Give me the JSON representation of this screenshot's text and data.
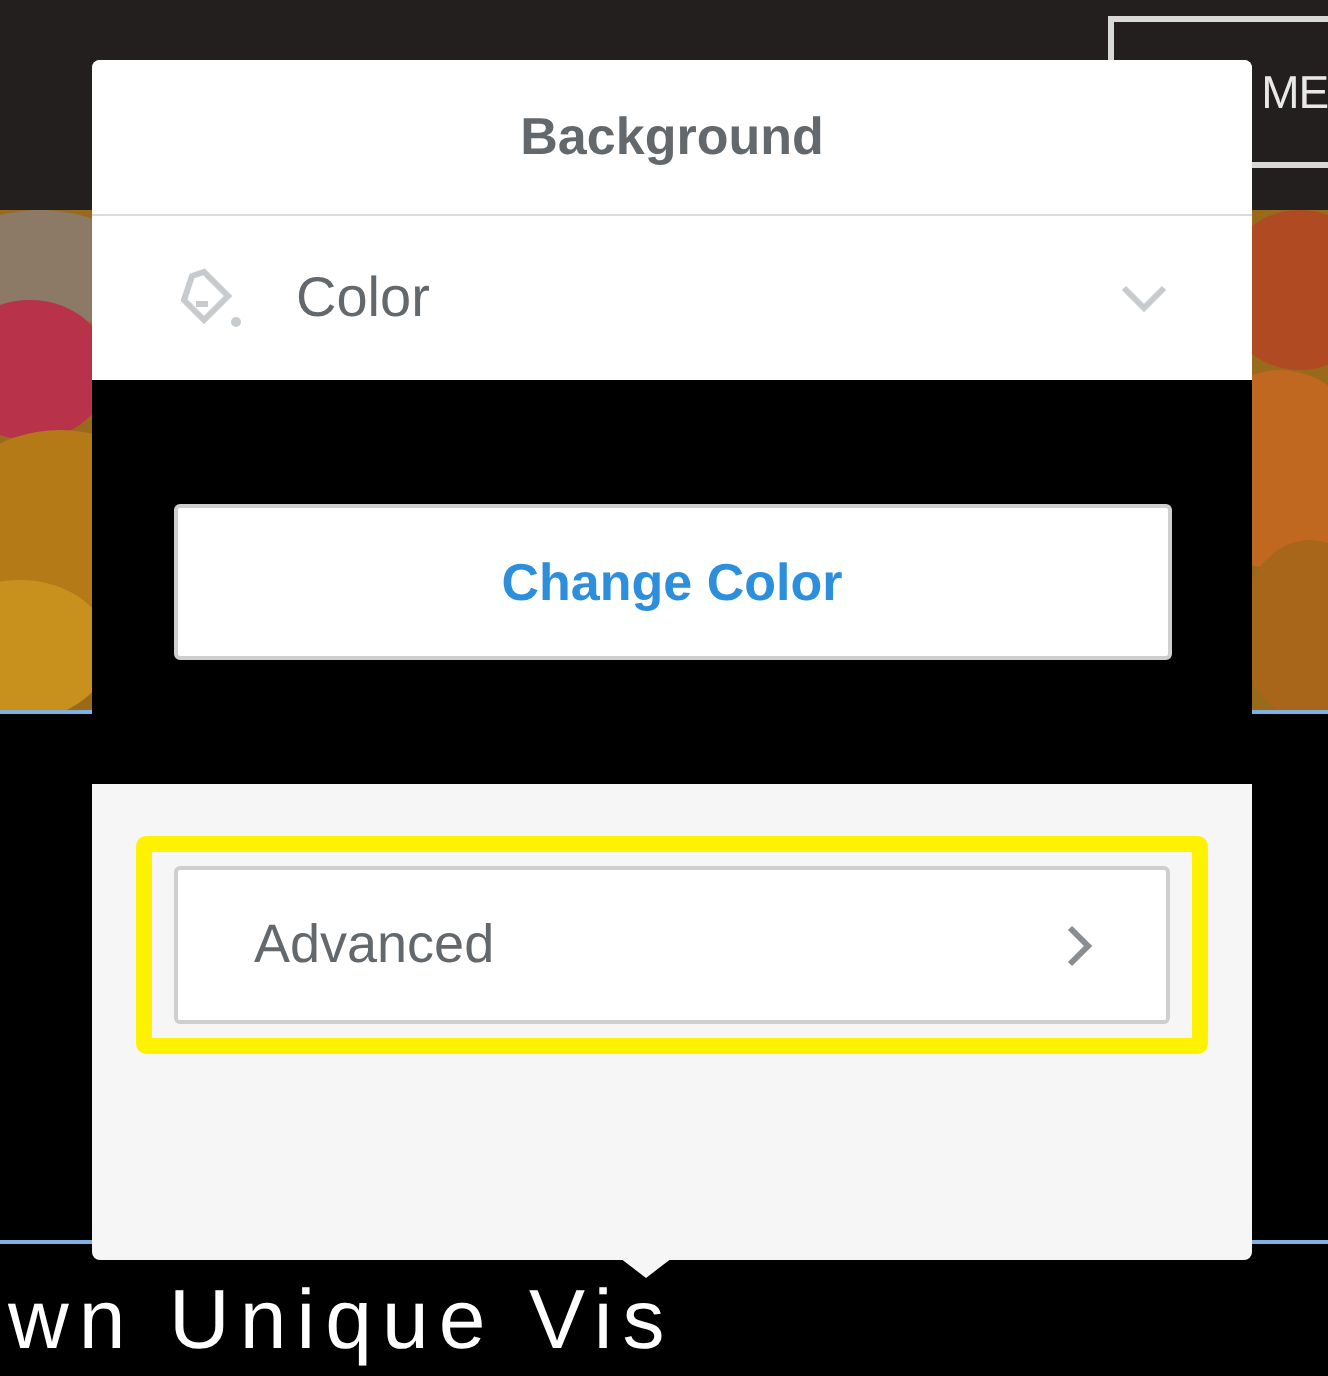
{
  "page": {
    "corner_button": "ME",
    "headline": "wn Unique Vis"
  },
  "dialog": {
    "title": "Background",
    "type_select": {
      "value": "Color",
      "expanded": false
    },
    "change_button": "Change Color",
    "advanced": {
      "label": "Advanced",
      "highlighted": true
    }
  }
}
